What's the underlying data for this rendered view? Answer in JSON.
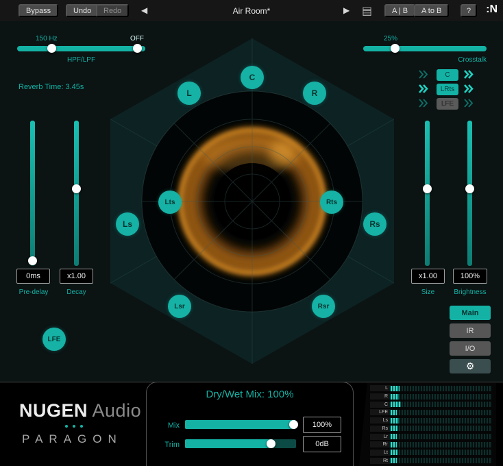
{
  "colors": {
    "accent": "#14b2a5",
    "glow": "#e08a1e"
  },
  "topbar": {
    "bypass": "Bypass",
    "undo": "Undo",
    "redo": "Redo",
    "back_icon": "◀",
    "title": "Air Room*",
    "play_icon": "▶",
    "list_icon": "▤",
    "ab": "A | B",
    "a_to_b": "A to B",
    "help": "?",
    "logo": ":N"
  },
  "filters": {
    "hpf_value": "150 Hz",
    "lpf_value": "OFF",
    "label": "HPF/LPF"
  },
  "crosstalk": {
    "value": "25%",
    "label": "Crosstalk"
  },
  "reverb_time": "Reverb Time: 3.45s",
  "routing": {
    "row1": "C",
    "row2": "LRts",
    "row3": "LFE"
  },
  "nodes": {
    "c": "C",
    "l": "L",
    "r": "R",
    "lts": "Lts",
    "rts": "Rts",
    "ls": "Ls",
    "rs": "Rs",
    "lsr": "Lsr",
    "rsr": "Rsr",
    "lfe": "LFE"
  },
  "params": {
    "predelay_value": "0ms",
    "predelay_label": "Pre-delay",
    "decay_value": "x1.00",
    "decay_label": "Decay",
    "size_value": "x1.00",
    "size_label": "Size",
    "brightness_value": "100%",
    "brightness_label": "Brightness"
  },
  "view_buttons": {
    "main": "Main",
    "ir": "IR",
    "io": "I/O",
    "gear_icon": "⚙"
  },
  "bottom": {
    "brand_name": "NUGEN",
    "brand_sub": "Audio",
    "product": "PARAGON",
    "drywet": "Dry/Wet Mix: 100%",
    "mix_label": "Mix",
    "mix_value": "100%",
    "trim_label": "Trim",
    "trim_value": "0dB"
  },
  "meters": {
    "labels": [
      "L",
      "R",
      "C",
      "LFE",
      "Ls",
      "Rs",
      "Lr",
      "Rr",
      "Lt",
      "Rt"
    ],
    "levels": [
      9,
      8,
      10,
      6,
      8,
      7,
      6,
      6,
      7,
      6
    ]
  }
}
